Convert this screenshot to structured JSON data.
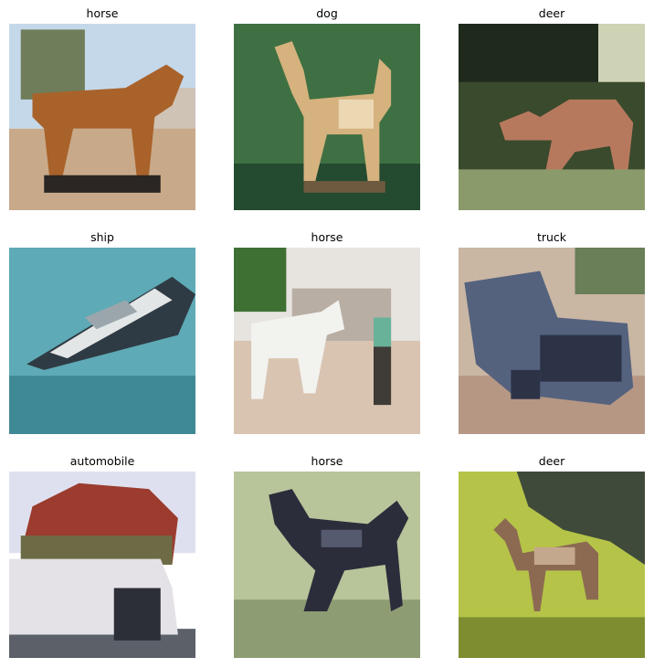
{
  "panels": [
    {
      "title": "horse",
      "bg": "#a99f8e",
      "colors": {
        "sky": "#c4d8ea",
        "tree": "#6f7d5a",
        "horse": "#a9622a",
        "ground": "#c8aa8a",
        "building": "#cfc3b6",
        "dark": "#2b2623"
      }
    },
    {
      "title": "dog",
      "bg": "#3e6a45",
      "colors": {
        "grass": "#3f7043",
        "grass_dark": "#244a2f",
        "dog": "#d5b27e",
        "dog_light": "#ecd7b3",
        "shadow": "#6e5a3e"
      }
    },
    {
      "title": "deer",
      "bg": "#4d5a3c",
      "colors": {
        "forest": "#3a4a2d",
        "forest_dark": "#1f2a1d",
        "deer": "#b7795e",
        "plants": "#8a9a6a",
        "light": "#cdd3b4"
      }
    },
    {
      "title": "ship",
      "bg": "#5aa7b2",
      "colors": {
        "water": "#5eaab6",
        "water_dark": "#3f8895",
        "hull": "#2f3b44",
        "deck": "#e3e6e6",
        "cabin": "#9aa6ab"
      }
    },
    {
      "title": "horse",
      "bg": "#cdbdaf",
      "colors": {
        "sky": "#e7e3df",
        "tree": "#3f7033",
        "horse": "#f2f2ef",
        "ground": "#d8c4b1",
        "person": "#3f3b36",
        "shirt": "#68b29a",
        "building": "#b8aea3"
      }
    },
    {
      "title": "truck",
      "bg": "#8d87a0",
      "colors": {
        "body": "#54627e",
        "body_dark": "#2d3347",
        "ground": "#b69784",
        "bg_light": "#c9b6a3",
        "tree": "#6a7e58"
      }
    },
    {
      "title": "automobile",
      "bg": "#d8d5d8",
      "colors": {
        "sky": "#dfe0ef",
        "flowers": "#9b3c2e",
        "leaves": "#6d6b45",
        "car": "#e4e2e6",
        "tire": "#2c2e38",
        "road": "#5b6069"
      }
    },
    {
      "title": "horse",
      "bg": "#a9b58a",
      "colors": {
        "grass": "#b8c49a",
        "grass_dark": "#8e9c74",
        "horse": "#2b2d3b",
        "horse_light": "#565a6e"
      }
    },
    {
      "title": "deer",
      "bg": "#a3a53b",
      "colors": {
        "grass": "#b5c448",
        "grass_dark": "#7d8d2f",
        "shadow": "#3f4a3a",
        "deer": "#8c6a52",
        "deer_light": "#c4a88e"
      }
    }
  ]
}
